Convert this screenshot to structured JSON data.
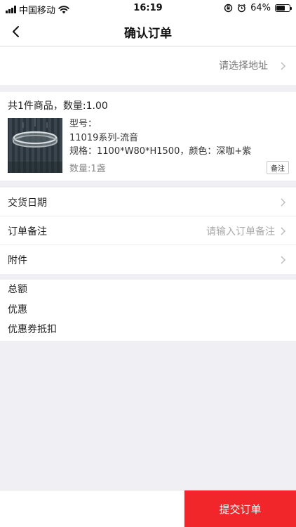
{
  "status_bar": {
    "carrier": "中国移动",
    "time": "16:19",
    "battery": "64%",
    "battery_level": 0.64
  },
  "nav": {
    "title": "确认订单",
    "back_icon": "chevron-left-icon"
  },
  "address": {
    "placeholder": "请选择地址"
  },
  "goods": {
    "summary": "共1件商品，数量:1.00",
    "model_label": "型号：",
    "model_name": "11019系列-流音",
    "spec": "规格：1100*W80*H1500，颜色：深咖+紫",
    "quantity": "数量:1盏",
    "remark_button": "备注"
  },
  "options": [
    {
      "label": "交货日期",
      "placeholder": ""
    },
    {
      "label": "订单备注",
      "placeholder": "请输入订单备注"
    },
    {
      "label": "附件",
      "placeholder": ""
    }
  ],
  "totals": [
    {
      "label": "总额"
    },
    {
      "label": "优惠"
    },
    {
      "label": "优惠券抵扣"
    }
  ],
  "bottom": {
    "submit_label": "提交订单"
  },
  "colors": {
    "accent": "#f0262b",
    "background": "#efeff4"
  }
}
